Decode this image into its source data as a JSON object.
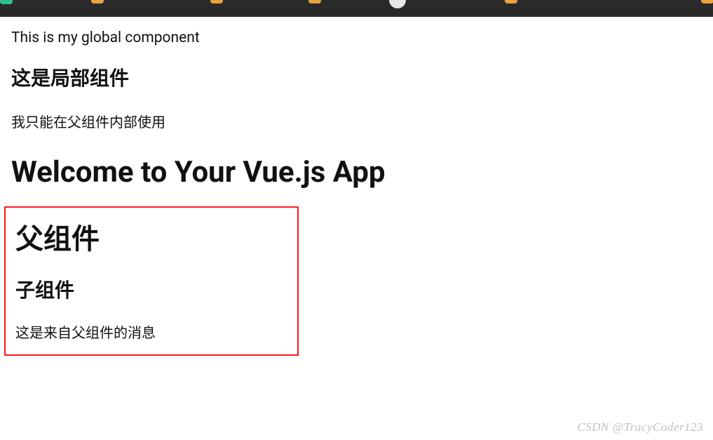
{
  "global_component_text": "This is my global component",
  "local_component": {
    "heading": "这是局部组件",
    "description": "我只能在父组件内部使用"
  },
  "welcome_heading": "Welcome to Your Vue.js App",
  "parent_component": {
    "heading": "父组件",
    "child": {
      "heading": "子组件",
      "message": "这是来自父组件的消息"
    }
  },
  "watermark": "CSDN @TracyCoder123"
}
